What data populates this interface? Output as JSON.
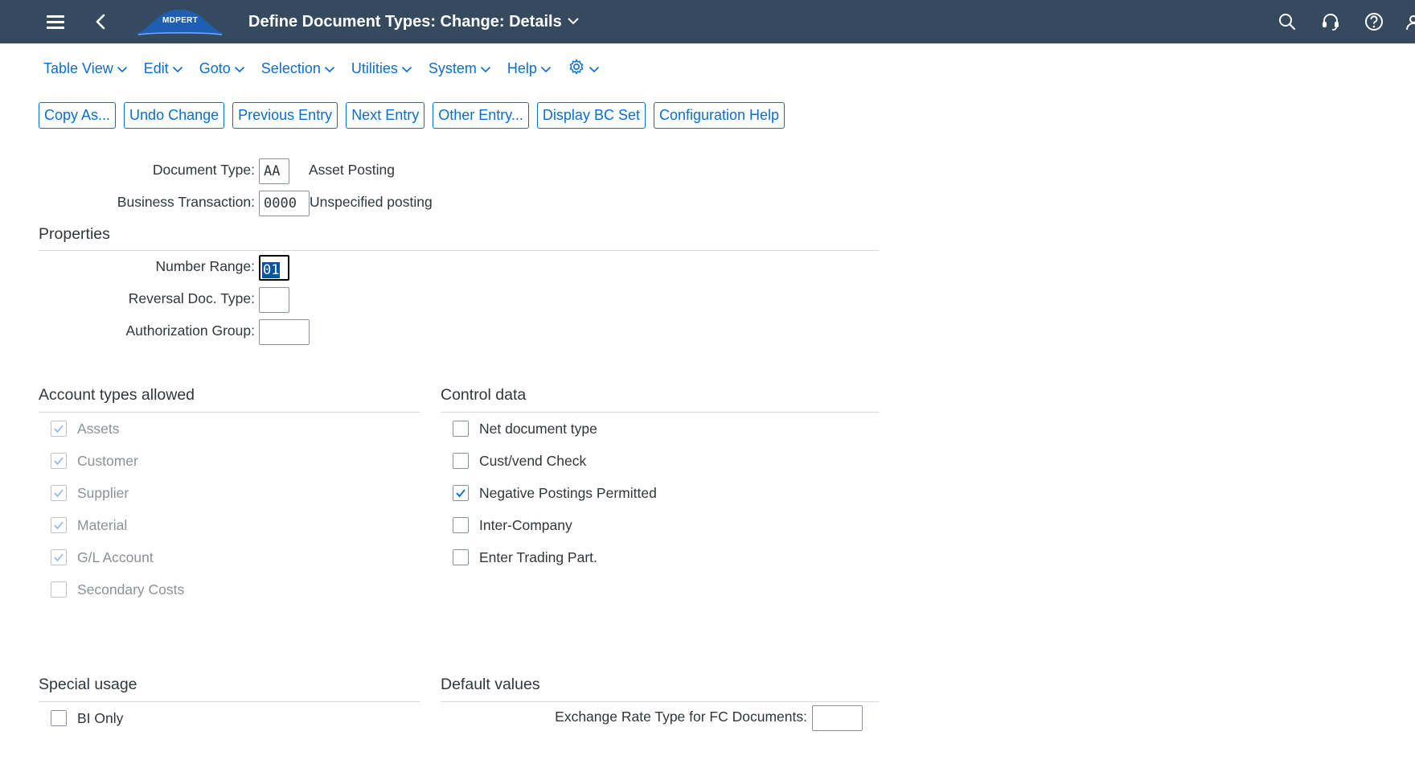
{
  "shell": {
    "logo_text": "MDPERT",
    "title": "Define Document Types: Change: Details"
  },
  "menu": {
    "items": [
      {
        "label": "Table View"
      },
      {
        "label": "Edit"
      },
      {
        "label": "Goto"
      },
      {
        "label": "Selection"
      },
      {
        "label": "Utilities"
      },
      {
        "label": "System"
      },
      {
        "label": "Help"
      }
    ],
    "settings_icon": "gear-icon"
  },
  "toolbar": {
    "buttons": [
      {
        "label": "Copy As..."
      },
      {
        "label": "Undo Change"
      },
      {
        "label": "Previous Entry"
      },
      {
        "label": "Next Entry"
      },
      {
        "label": "Other Entry..."
      },
      {
        "label": "Display BC Set"
      },
      {
        "label": "Configuration Help"
      }
    ]
  },
  "header": {
    "document_type_label": "Document Type:",
    "document_type_value": "AA",
    "document_type_text": "Asset Posting",
    "business_transaction_label": "Business Transaction:",
    "business_transaction_value": "0000",
    "business_transaction_text": "Unspecified posting"
  },
  "properties": {
    "title": "Properties",
    "number_range_label": "Number Range:",
    "number_range_value": "01",
    "reversal_doc_type_label": "Reversal Doc. Type:",
    "reversal_doc_type_value": "",
    "authorization_group_label": "Authorization Group:",
    "authorization_group_value": ""
  },
  "account_types": {
    "title": "Account types allowed",
    "items": [
      {
        "label": "Assets",
        "checked": true
      },
      {
        "label": "Customer",
        "checked": true
      },
      {
        "label": "Supplier",
        "checked": true
      },
      {
        "label": "Material",
        "checked": true
      },
      {
        "label": "G/L Account",
        "checked": true
      },
      {
        "label": "Secondary Costs",
        "checked": false
      }
    ]
  },
  "control_data": {
    "title": "Control data",
    "items": [
      {
        "label": "Net document type",
        "checked": false
      },
      {
        "label": "Cust/vend Check",
        "checked": false
      },
      {
        "label": "Negative Postings Permitted",
        "checked": true
      },
      {
        "label": "Inter-Company",
        "checked": false
      },
      {
        "label": "Enter Trading Part.",
        "checked": false
      }
    ]
  },
  "special_usage": {
    "title": "Special usage",
    "bi_only_label": "BI Only",
    "bi_only_checked": false
  },
  "default_values": {
    "title": "Default values",
    "exchange_rate_label": "Exchange Rate Type for FC Documents:",
    "exchange_rate_value": ""
  },
  "colors": {
    "shell_bg": "#354a5f",
    "accent": "#0a6ed1",
    "check_active": "#0a6ed1",
    "check_disabled": "#8fb8e3"
  }
}
